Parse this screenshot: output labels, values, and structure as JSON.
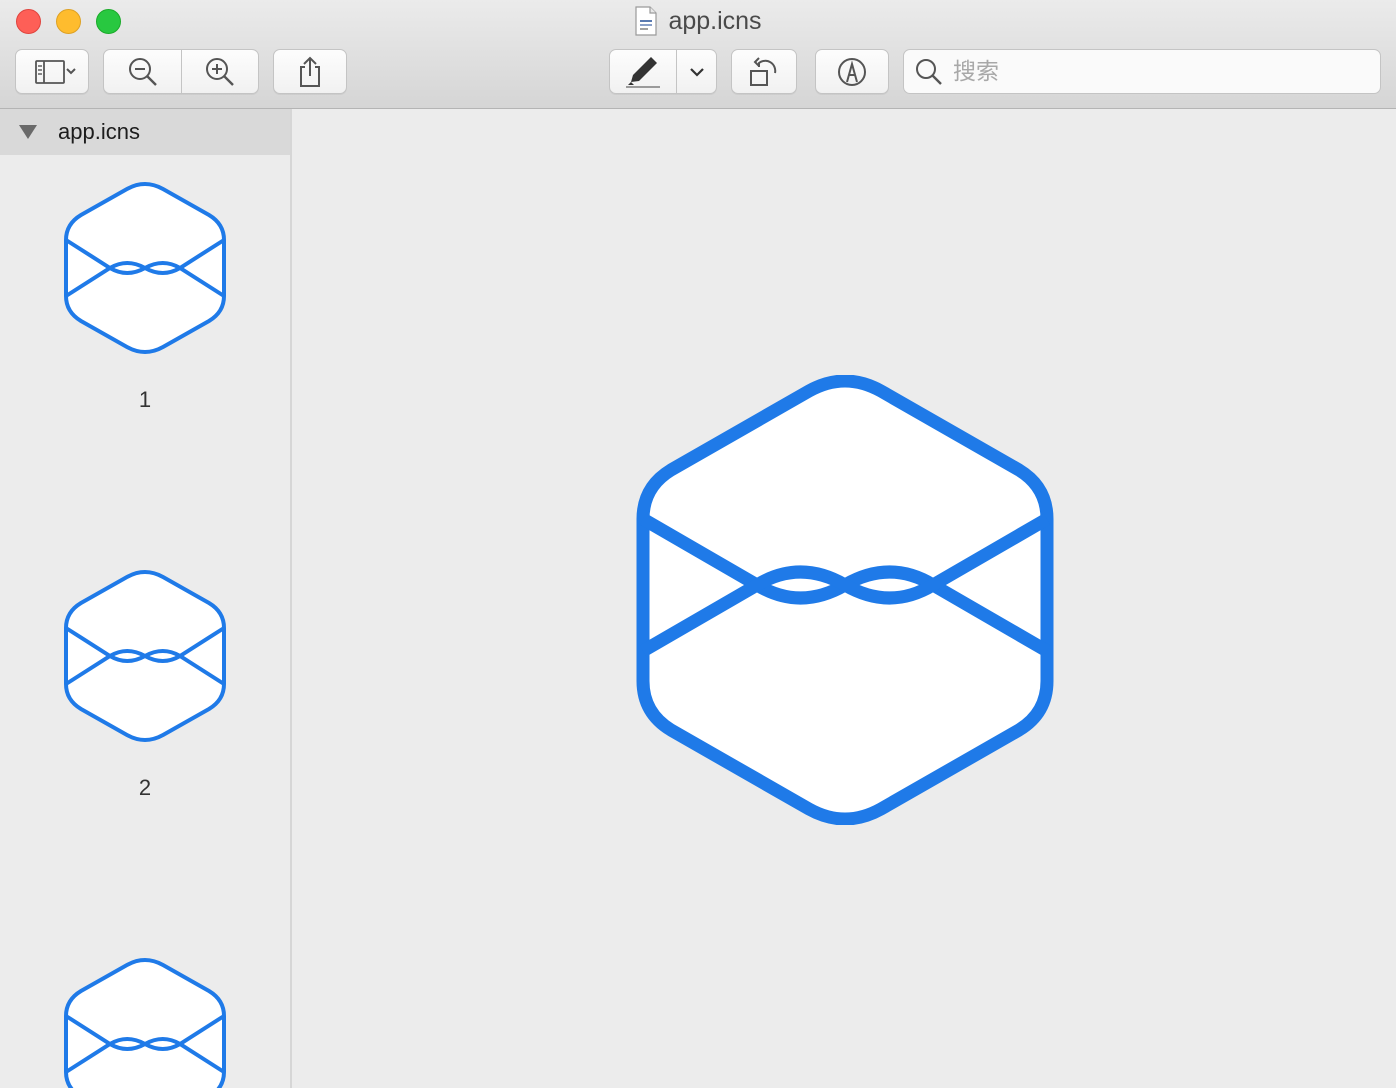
{
  "window": {
    "title": "app.icns"
  },
  "toolbar": {
    "sidebar_toggle_icon": "sidebar-icon",
    "zoom_out_icon": "zoom-out-icon",
    "zoom_in_icon": "zoom-in-icon",
    "share_icon": "share-icon",
    "highlight_icon": "highlighter-icon",
    "rotate_icon": "rotate-left-icon",
    "markup_icon": "markup-pen-icon",
    "search_placeholder": "搜索"
  },
  "sidebar": {
    "header_label": "app.icns",
    "thumbnails": [
      {
        "label": "1"
      },
      {
        "label": "2"
      },
      {
        "label": ""
      }
    ]
  },
  "colors": {
    "icon_blue": "#1f7ae8",
    "close": "#fe5f57",
    "minimize": "#febc2e",
    "maximize": "#28c840"
  }
}
